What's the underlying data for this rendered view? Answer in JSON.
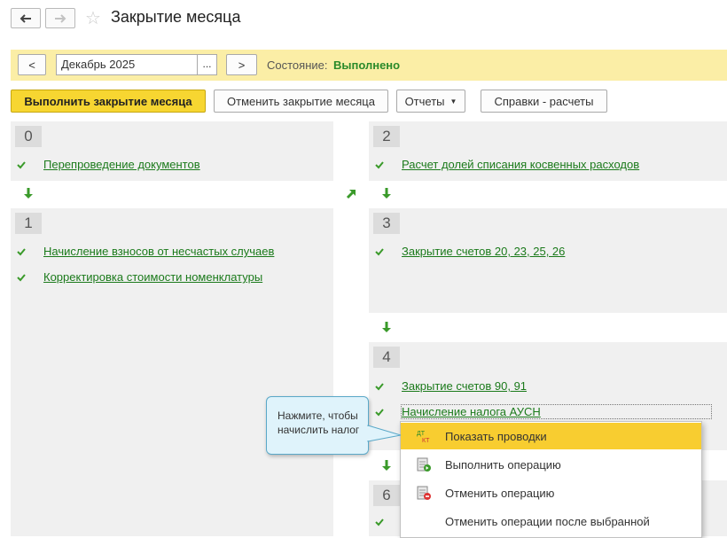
{
  "window": {
    "title": "Закрытие месяца",
    "back_icon": "arrow-left-icon",
    "forward_icon": "arrow-right-icon",
    "favorite_icon": "star-icon"
  },
  "period_bar": {
    "prev_label": "<",
    "period_value": "Декабрь 2025",
    "select_label": "...",
    "next_label": ">",
    "state_label": "Состояние:",
    "state_value": "Выполнено",
    "state_color": "#2a8a2a",
    "bar_color": "#fbeea6"
  },
  "toolbar": {
    "run_label": "Выполнить закрытие месяца",
    "cancel_label": "Отменить закрытие месяца",
    "reports_label": "Отчеты",
    "refs_label": "Справки - расчеты"
  },
  "stages": [
    {
      "number": "0",
      "operations": [
        "Перепроведение документов"
      ]
    },
    {
      "number": "1",
      "operations": [
        "Начисление взносов от несчастых случаев",
        "Корректировка стоимости номенклатуры"
      ]
    },
    {
      "number": "2",
      "operations": [
        "Расчет долей списания косвенных расходов"
      ]
    },
    {
      "number": "3",
      "operations": [
        "Закрытие счетов 20, 23, 25, 26"
      ]
    },
    {
      "number": "4",
      "operations": [
        "Закрытие счетов 90, 91",
        "Начисление налога АУСН"
      ]
    },
    {
      "number": "6",
      "operations": []
    }
  ],
  "context_menu": {
    "items": [
      {
        "label": "Показать проводки",
        "icon": "dt-kt-icon",
        "active": true
      },
      {
        "label": "Выполнить операцию",
        "icon": "run-operation-icon",
        "active": false
      },
      {
        "label": "Отменить операцию",
        "icon": "cancel-operation-icon",
        "active": false
      },
      {
        "label": "Отменить операции после выбранной",
        "icon": "",
        "active": false
      }
    ]
  },
  "tooltip": {
    "text": "Нажмите, чтобы начислить налог"
  },
  "colors": {
    "accent": "#f7d631",
    "link": "#1b7a1b",
    "check": "#3a9a2a",
    "panel": "#f0f0f0"
  }
}
